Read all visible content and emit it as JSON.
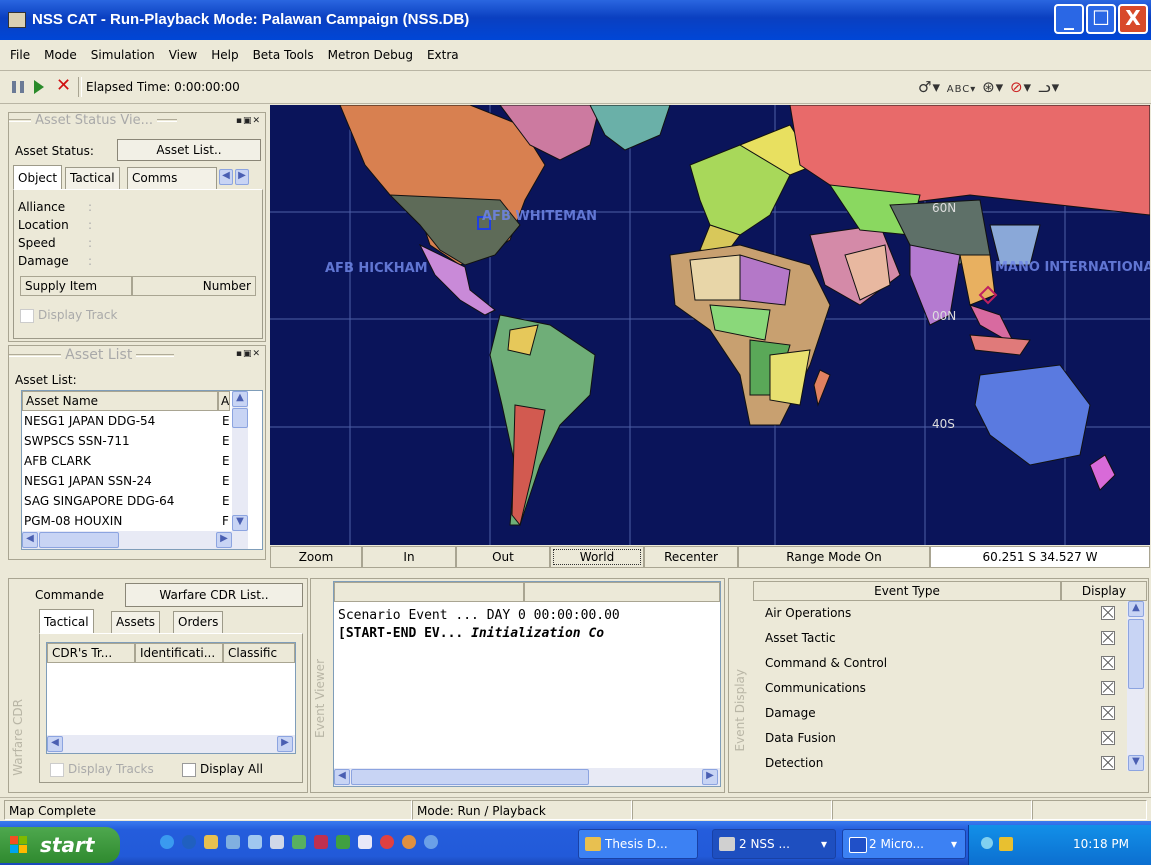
{
  "window": {
    "title": "NSS CAT - Run-Playback Mode: Palawan Campaign (NSS.DB)",
    "minimize": "_",
    "maximize": "☐",
    "close": "X"
  },
  "menu": [
    "File",
    "Mode",
    "Simulation",
    "View",
    "Help",
    "Beta Tools",
    "Metron Debug",
    "Extra"
  ],
  "toolbar": {
    "elapsed_label": "Elapsed Time: 0:00:00:00"
  },
  "asset_status": {
    "caption": "Asset Status Vie...",
    "status_label": "Asset Status:",
    "asset_list_button": "Asset List..",
    "tabs": [
      "Object",
      "Tactical",
      "Comms"
    ],
    "fields": [
      "Alliance",
      "Location",
      "Speed",
      "Damage"
    ],
    "supply_col": "Supply Item",
    "number_col": "Number",
    "display_track": "Display Track"
  },
  "asset_list": {
    "caption": "Asset List",
    "label": "Asset List:",
    "col_name": "Asset Name",
    "col_a": "A",
    "rows": [
      {
        "name": "NESG1 JAPAN DDG-54",
        "a": "E"
      },
      {
        "name": "SWPSCS SSN-711",
        "a": "E"
      },
      {
        "name": "AFB CLARK",
        "a": "E"
      },
      {
        "name": "NESG1 JAPAN SSN-24",
        "a": "E"
      },
      {
        "name": "SAG SINGAPORE DDG-64",
        "a": "E"
      },
      {
        "name": "PGM-08 HOUXIN",
        "a": "F"
      }
    ]
  },
  "map": {
    "labels": [
      "AFB WHITEMAN",
      "AFB HICKHAM",
      "MANO INTERNATIONAL",
      "60N",
      "00N",
      "40S"
    ],
    "controls": [
      "Zoom",
      "In",
      "Out",
      "World",
      "Recenter",
      "Range Mode On"
    ],
    "coords": "60.251 S 34.527 W"
  },
  "warfare_cdr": {
    "side_label": "Warfare CDR",
    "commander_label": "Commande",
    "cdr_list_button": "Warfare CDR List..",
    "tabs": [
      "Tactical",
      "Assets",
      "Orders"
    ],
    "cols": [
      "CDR's Tr...",
      "Identificati...",
      "Classific"
    ],
    "display_tracks": "Display Tracks",
    "display_all": "Display All"
  },
  "event_viewer": {
    "side_label": "Event Viewer",
    "line1": "Scenario Event ... DAY 0 00:00:00.00",
    "line2_a": "[START-END EV... ",
    "line2_b": "Initialization Co"
  },
  "event_display": {
    "side_label": "Event Display",
    "col_type": "Event Type",
    "col_display": "Display",
    "events": [
      "Air Operations",
      "Asset Tactic",
      "Command & Control",
      "Communications",
      "Damage",
      "Data Fusion",
      "Detection"
    ]
  },
  "status": {
    "left": "Map Complete",
    "mode": "Mode: Run / Playback"
  },
  "taskbar": {
    "start": "start",
    "tasks": [
      "Thesis D...",
      "2 NSS ...",
      "2 Micro..."
    ],
    "clock": "10:18 PM"
  }
}
